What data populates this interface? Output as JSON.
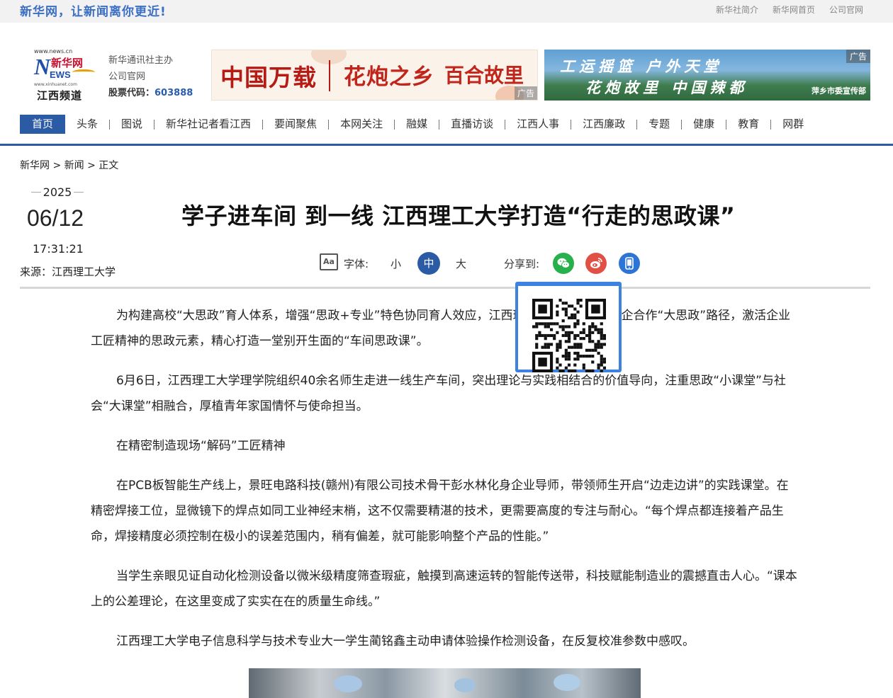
{
  "topbar": {
    "slogan": "新华网，让新闻离你更近!",
    "links": [
      "新华社简介",
      "新华网首页",
      "公司官网"
    ]
  },
  "header": {
    "logo": {
      "site": "www.news.cn",
      "brand": "新华网",
      "letter": "N",
      "letters": "EWS",
      "url": "www.xinhuanet.com",
      "channel": "江西频道"
    },
    "host_line1": "新华通讯社主办",
    "host_line2": "公司官网",
    "stock_label": "股票代码：",
    "stock_code": "603888"
  },
  "ads": {
    "ad1": {
      "part1": "中国万载",
      "part2": "花炮之乡",
      "part3": "百合故里",
      "tag": "广告"
    },
    "ad2": {
      "line1": "工运摇篮 户外天堂",
      "line2": "花炮故里 中国辣都",
      "org": "萍乡市委宣传部",
      "tag": "广告"
    }
  },
  "nav": {
    "items": [
      "首页",
      "头条",
      "图说",
      "新华社记者看江西",
      "要闻聚焦",
      "本网关注",
      "融媒",
      "直播访谈",
      "江西人事",
      "江西廉政",
      "专题",
      "健康",
      "教育",
      "网群"
    ],
    "active_index": 0
  },
  "breadcrumb": [
    "新华网",
    "新闻",
    "正文"
  ],
  "breadcrumb_sep": " > ",
  "article": {
    "year": "2025",
    "month_day": "06/12",
    "time": "17:31:21",
    "source": "来源：江西理工大学",
    "title": "学子进车间 到一线 江西理工大学打造“行走的思政课”",
    "paragraphs": [
      "为构建高校“大思政”育人体系，增强“思政+专业”特色协同育人效应，江西理工大学积极探索校企合作“大思政”路径，激活企业工匠精神的思政元素，精心打造一堂别开生面的“车间思政课”。",
      "6月6日，江西理工大学理学院组织40余名师生走进一线生产车间，突出理论与实践相结合的价值导向，注重思政“小课堂”与社会“大课堂”相融合，厚植青年家国情怀与使命担当。",
      "在精密制造现场“解码”工匠精神",
      "在PCB板智能生产线上，景旺电路科技(赣州)有限公司技术骨干彭水林化身企业导师，带领师生开启“边走边讲”的实践课堂。在精密焊接工位，显微镜下的焊点如同工业神经末梢，这不仅需要精湛的技术，更需要高度的专注与耐心。“每个焊点都连接着产品生命，焊接精度必须控制在极小的误差范围内，稍有偏差，就可能影响整个产品的性能。”",
      "当学生亲眼见证自动化检测设备以微米级精度筛查瑕疵，触摸到高速运转的智能传送带，科技赋能制造业的震撼直击人心。“课本上的公差理论，在这里变成了实实在在的质量生命线。”",
      "江西理工大学电子信息科学与技术专业大一学生蔺铭鑫主动申请体验操作检测设备，在反复校准参数中感叹。"
    ]
  },
  "tools": {
    "font_icon": "Aa",
    "font_label": "字体:",
    "size_small": "小",
    "size_mid": "中",
    "size_big": "大",
    "share_label": "分享到:"
  },
  "icons": [
    "font-size-icon",
    "wechat-icon",
    "weibo-icon",
    "mobile-icon",
    "qr-code-icon"
  ],
  "colors": {
    "brand_blue": "#2c5ba5",
    "wechat": "#27b14c",
    "weibo": "#e24f44",
    "mobile": "#2c74d6",
    "qr_border": "#3d82e0"
  }
}
